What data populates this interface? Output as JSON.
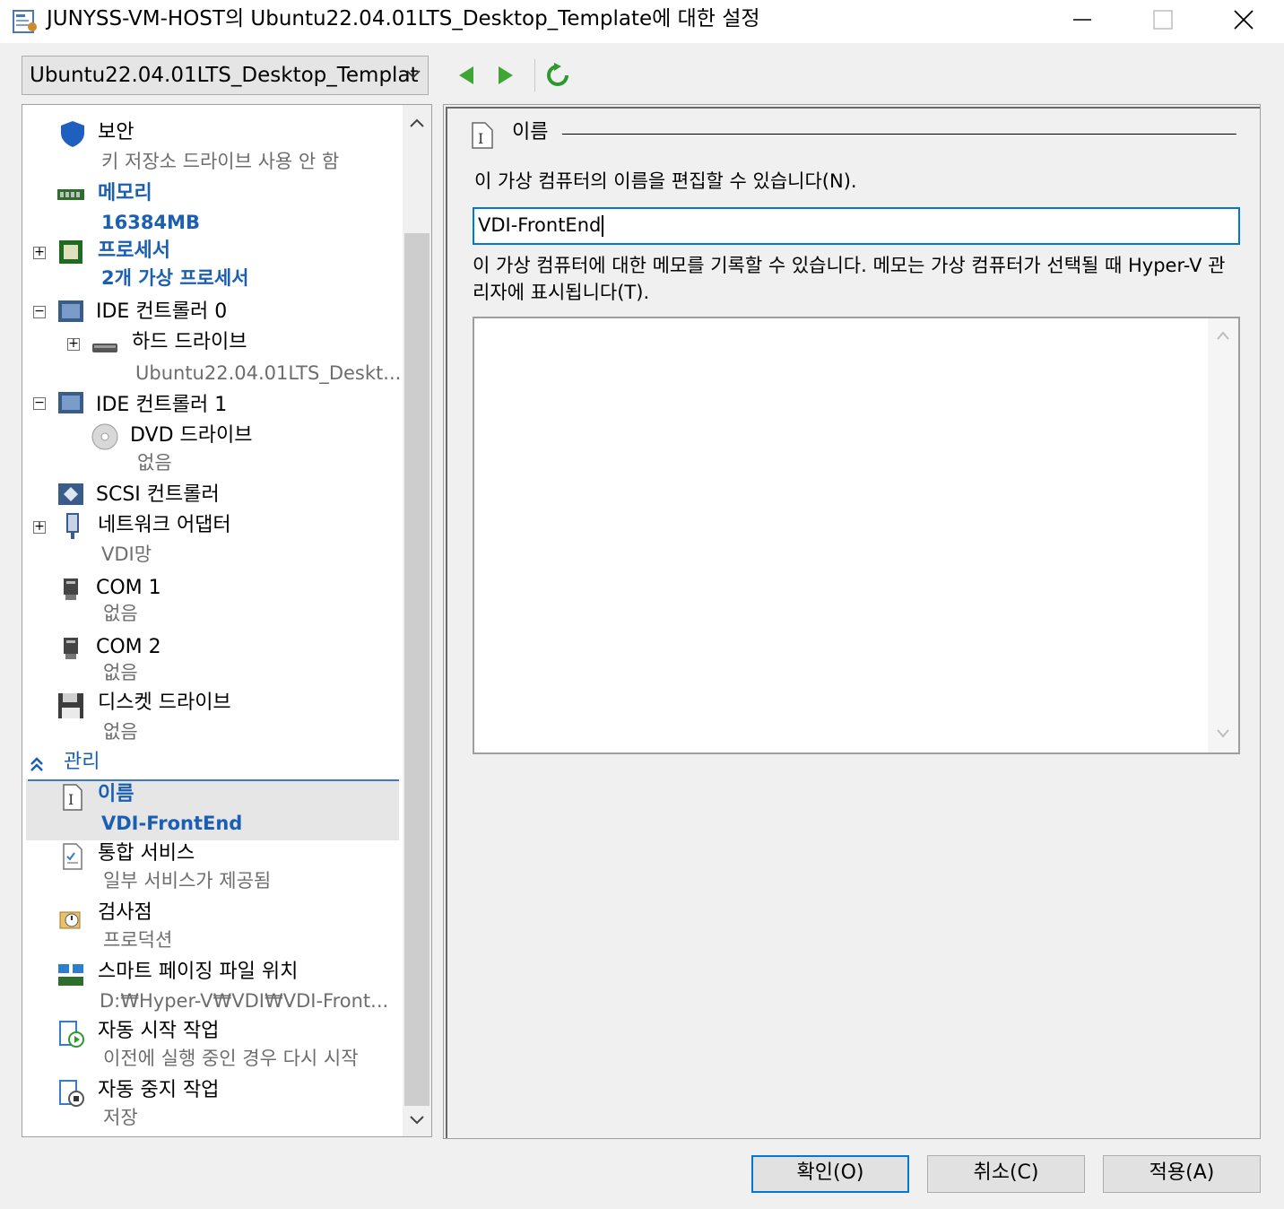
{
  "window": {
    "title": "JUNYSS-VM-HOST의 Ubuntu22.04.01LTS_Desktop_Template에 대한 설정"
  },
  "toolbar": {
    "vm_selected": "Ubuntu22.04.01LTS_Desktop_Templat"
  },
  "tree": {
    "items": [
      {
        "label": "보안",
        "sub": "키 저장소 드라이브 사용 안 함",
        "icon": "shield-icon"
      },
      {
        "label": "메모리",
        "sub": "16384MB",
        "icon": "memory-icon"
      },
      {
        "label": "프로세서",
        "sub": "2개 가상 프로세서",
        "icon": "processor-icon"
      },
      {
        "label": "IDE 컨트롤러 0",
        "icon": "controller-icon"
      },
      {
        "label": "하드 드라이브",
        "sub": "Ubuntu22.04.01LTS_Deskt...",
        "icon": "hard-drive-icon"
      },
      {
        "label": "IDE 컨트롤러 1",
        "icon": "controller-icon"
      },
      {
        "label": "DVD 드라이브",
        "sub": "없음",
        "icon": "dvd-icon"
      },
      {
        "label": "SCSI 컨트롤러",
        "icon": "scsi-icon"
      },
      {
        "label": "네트워크 어댑터",
        "sub": "VDI망",
        "icon": "network-adapter-icon"
      },
      {
        "label": "COM 1",
        "sub": "없음",
        "icon": "com-port-icon"
      },
      {
        "label": "COM 2",
        "sub": "없음",
        "icon": "com-port-icon"
      },
      {
        "label": "디스켓 드라이브",
        "sub": "없음",
        "icon": "floppy-icon"
      }
    ],
    "section_management": "관리",
    "management_items": [
      {
        "label": "이름",
        "sub": "VDI-FrontEnd",
        "icon": "name-icon"
      },
      {
        "label": "통합 서비스",
        "sub": "일부 서비스가 제공됨",
        "icon": "integration-icon"
      },
      {
        "label": "검사점",
        "sub": "프로덕션",
        "icon": "checkpoint-icon"
      },
      {
        "label": "스마트 페이징 파일 위치",
        "sub": "D:₩Hyper-V₩VDI₩VDI-Front...",
        "icon": "paging-icon"
      },
      {
        "label": "자동 시작 작업",
        "sub": "이전에 실행 중인 경우 다시 시작",
        "icon": "auto-start-icon"
      },
      {
        "label": "자동 중지 작업",
        "sub": "저장",
        "icon": "auto-stop-icon"
      }
    ]
  },
  "detail": {
    "group_title": "이름",
    "name_description": "이 가상 컴퓨터의 이름을 편집할 수 있습니다(N).",
    "name_value": "VDI-FrontEnd",
    "notes_description": "이 가상 컴퓨터에 대한 메모를 기록할 수 있습니다. 메모는 가상 컴퓨터가 선택될 때 Hyper-V 관리자에 표시됩니다(T).",
    "notes_value": ""
  },
  "buttons": {
    "ok": "확인(O)",
    "cancel": "취소(C)",
    "apply": "적용(A)"
  },
  "colors": {
    "accent": "#0078d7",
    "link_blue": "#1a5fb4",
    "nav_green": "#3fa535"
  }
}
